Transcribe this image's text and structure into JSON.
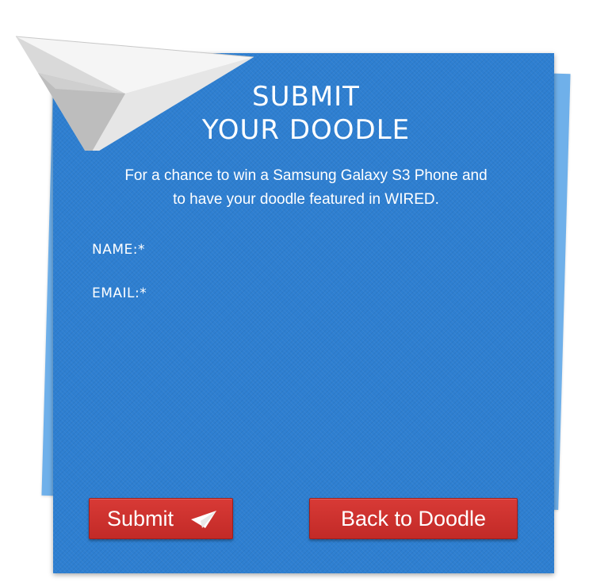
{
  "header": {
    "title_line1": "SUBMIT",
    "title_line2": "YOUR DOODLE"
  },
  "intro": {
    "line1": "For a chance to win a Samsung Galaxy S3 Phone and",
    "line2": "to have your doodle featured in WIRED."
  },
  "form": {
    "name_label": "NAME:*",
    "name_value": "",
    "email_label": "EMAIL:*",
    "email_value": ""
  },
  "buttons": {
    "submit_label": "Submit",
    "back_label": "Back to Doodle"
  },
  "icons": {
    "decoration": "paper-plane-icon",
    "submit": "paper-plane-icon"
  },
  "colors": {
    "card_blue": "#2e7fd1",
    "back_sheet_blue": "#6fb0ea",
    "button_red": "#c22a27",
    "text": "#ffffff"
  }
}
